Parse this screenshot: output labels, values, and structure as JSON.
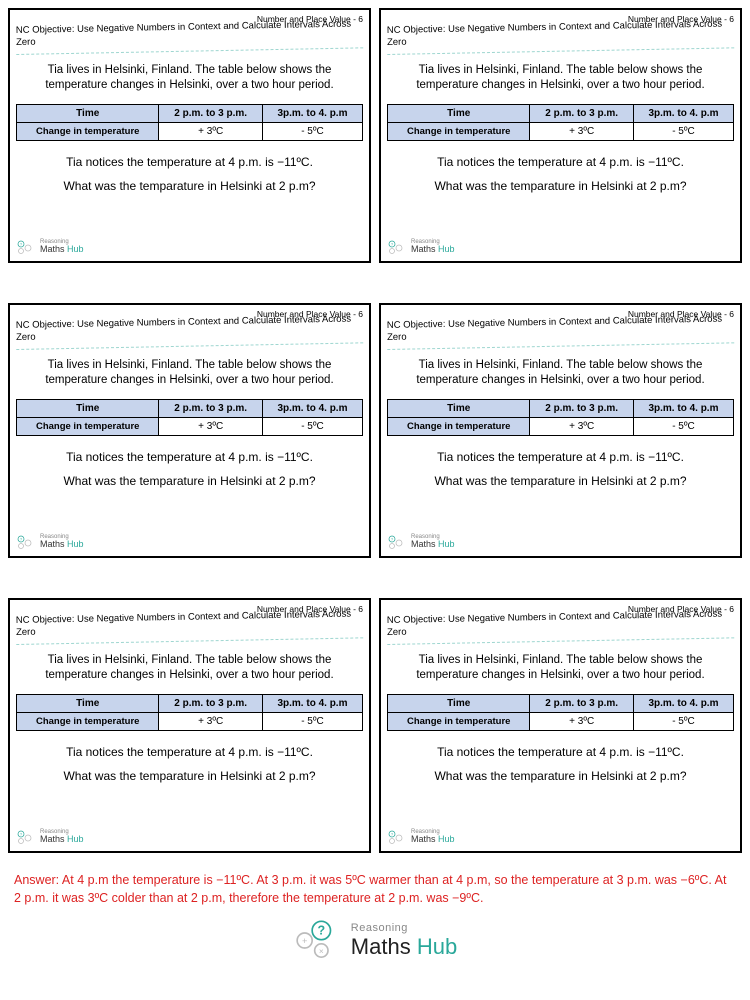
{
  "topic": "Number and Place Value - 6",
  "objective": "NC Objective: Use Negative Numbers in Context and Calculate Intervals Across Zero",
  "intro": "Tia lives in Helsinki, Finland. The table below shows the temperature changes in Helsinki, over a two hour period.",
  "table": {
    "header_time": "Time",
    "col1": "2 p.m. to 3 p.m.",
    "col2": "3p.m. to 4. p.m",
    "row_label": "Change in temperature",
    "val1": "+ 3ºC",
    "val2": "- 5ºC"
  },
  "observes_pre": "Tia notices the temperature at 4 p.m. is ",
  "observes_val": "−11ºC.",
  "question": "What was the temparature in Helsinki at 2 p.m?",
  "logo": {
    "reasoning": "Reasoning",
    "maths": "Maths ",
    "hub": "Hub"
  },
  "answer_pre": "Answer: At 4 p.m the temperature is  ",
  "answer_v1": "−11ºC",
  "answer_mid1": ". At 3 p.m. it was ",
  "answer_v2": "5ºC",
  "answer_mid2": " warmer than at 4 p.m, so the temperature at 3 p.m. was ",
  "answer_v3": "−6ºC",
  "answer_mid3": ". At 2 p.m. it was ",
  "answer_v4": "3ºC",
  "answer_mid4": " colder than at 2 p.m, therefore the temperature at 2 p.m. was ",
  "answer_v5": "−9ºC",
  "answer_end": "."
}
